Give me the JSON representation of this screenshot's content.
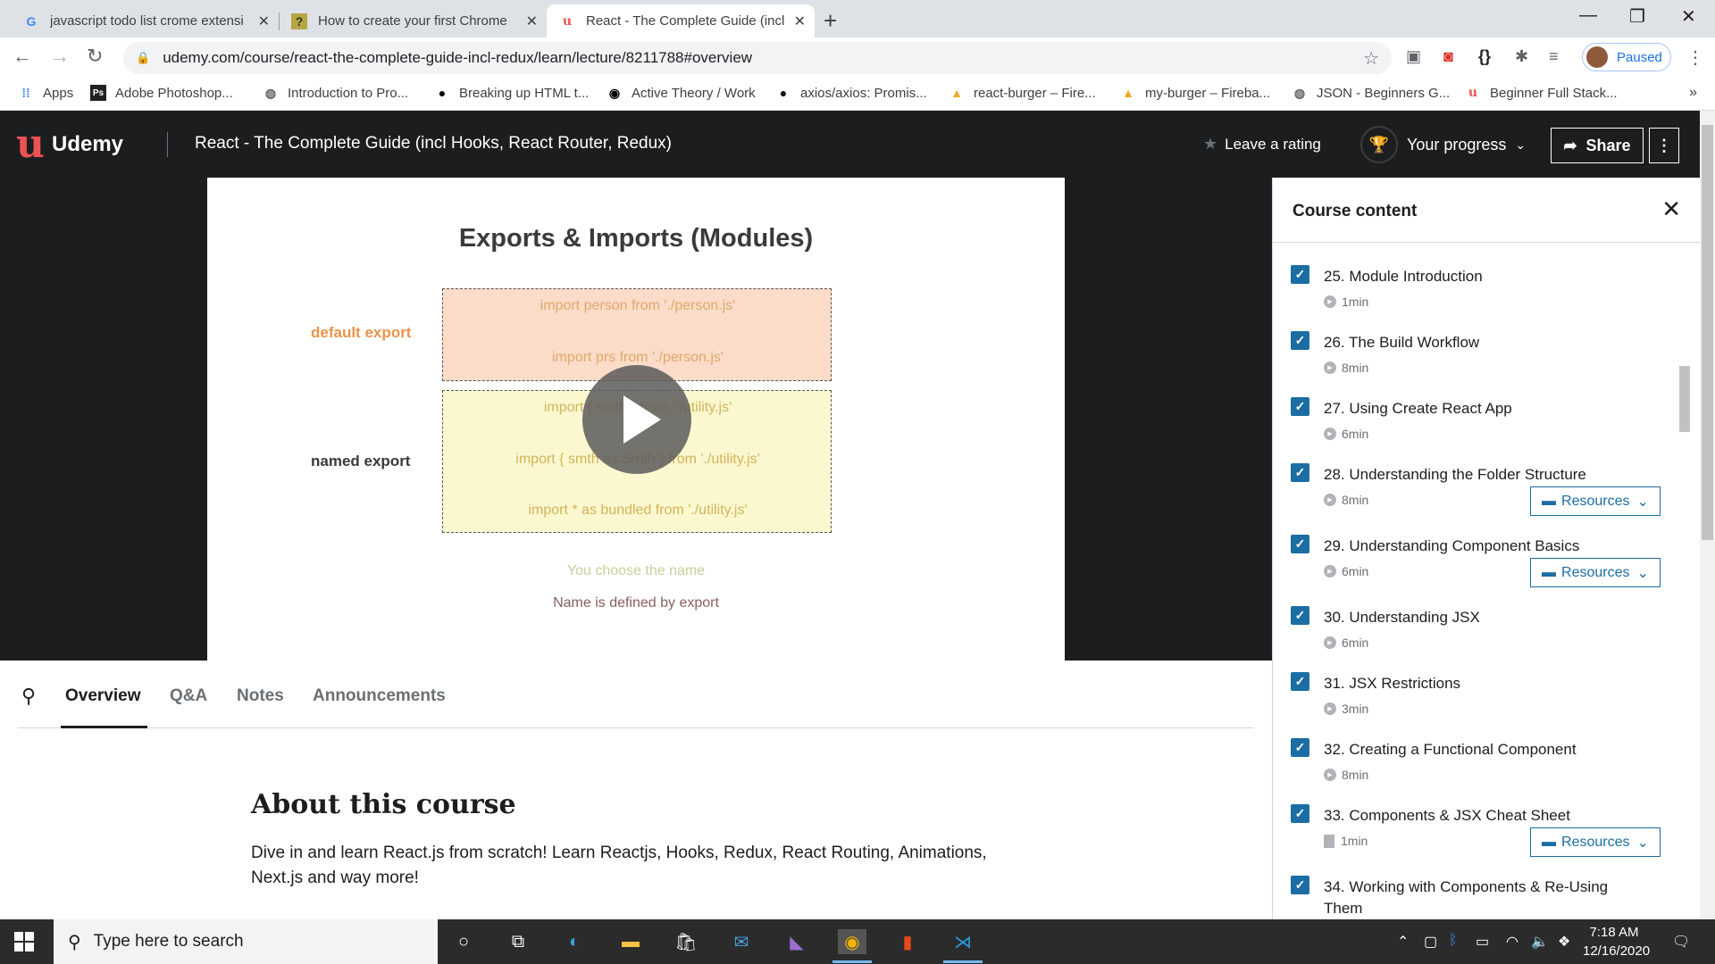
{
  "browser": {
    "tabs": [
      {
        "title": "javascript todo list crome extensi",
        "icon": "google-icon"
      },
      {
        "title": "How to create your first Chrome",
        "icon": "question-icon"
      },
      {
        "title": "React - The Complete Guide (incl",
        "icon": "udemy-icon"
      }
    ],
    "url": "udemy.com/course/react-the-complete-guide-incl-redux/learn/lecture/8211788#overview",
    "profile_status": "Paused",
    "bookmarks": [
      "Apps",
      "Adobe Photoshop...",
      "Introduction to Pro...",
      "Breaking up HTML t...",
      "Active Theory / Work",
      "axios/axios: Promis...",
      "react-burger – Fire...",
      "my-burger – Fireba...",
      "JSON - Beginners G...",
      "Beginner Full Stack..."
    ]
  },
  "header": {
    "logo": "Udemy",
    "course_title": "React - The Complete Guide (incl Hooks, React Router, Redux)",
    "rating_label": "Leave a rating",
    "progress_label": "Your progress",
    "share_label": "Share"
  },
  "slide": {
    "title": "Exports & Imports (Modules)",
    "default_label": "default export",
    "named_label": "named export",
    "default_lines": [
      "import person from './person.js'",
      "import prs from './person.js'"
    ],
    "named_lines": [
      "import { smth } from './utility.js'",
      "import { smth as Smth } from './utility.js'",
      "import * as bundled from './utility.js'"
    ],
    "note1": "You choose the name",
    "note2": "Name is defined by export"
  },
  "content_tabs": [
    "Overview",
    "Q&A",
    "Notes",
    "Announcements"
  ],
  "about": {
    "heading": "About this course",
    "text": "Dive in and learn React.js from scratch! Learn Reactjs, Hooks, Redux, React Routing, Animations, Next.js and way more!"
  },
  "sidebar": {
    "title": "Course content",
    "resources_label": "Resources",
    "items": [
      {
        "title": "25. Module Introduction",
        "duration": "1min",
        "type": "video",
        "resources": false
      },
      {
        "title": "26. The Build Workflow",
        "duration": "8min",
        "type": "video",
        "resources": false
      },
      {
        "title": "27. Using Create React App",
        "duration": "6min",
        "type": "video",
        "resources": false
      },
      {
        "title": "28. Understanding the Folder Structure",
        "duration": "8min",
        "type": "video",
        "resources": true
      },
      {
        "title": "29. Understanding Component Basics",
        "duration": "6min",
        "type": "video",
        "resources": true
      },
      {
        "title": "30. Understanding JSX",
        "duration": "6min",
        "type": "video",
        "resources": false
      },
      {
        "title": "31. JSX Restrictions",
        "duration": "3min",
        "type": "video",
        "resources": false
      },
      {
        "title": "32. Creating a Functional Component",
        "duration": "8min",
        "type": "video",
        "resources": false
      },
      {
        "title": "33. Components & JSX Cheat Sheet",
        "duration": "1min",
        "type": "article",
        "resources": true
      },
      {
        "title": "34. Working with Components & Re-Using Them",
        "duration": "",
        "type": "video",
        "resources": false
      }
    ]
  },
  "taskbar": {
    "search_placeholder": "Type here to search",
    "time": "7:18 AM",
    "date": "12/16/2020"
  },
  "colors": {
    "udemy_red": "#ec5252",
    "header_bg": "#1c1d1f",
    "checkbox_blue": "#1c6da3",
    "default_box": "#fbdcc8",
    "named_box": "#fbf8cf"
  }
}
